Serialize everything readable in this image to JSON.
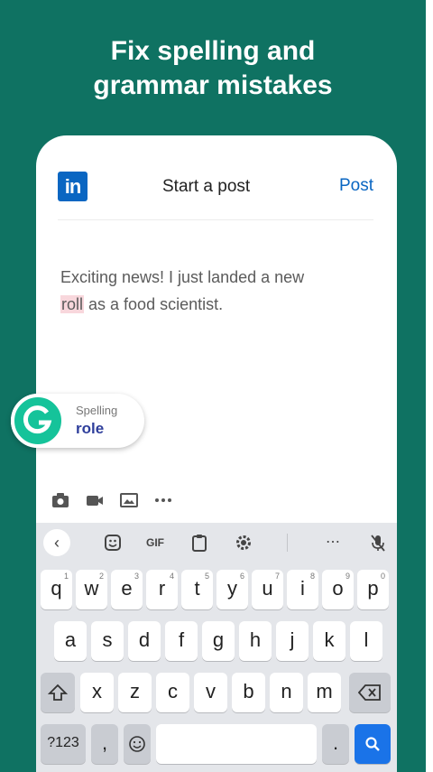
{
  "headline": {
    "line1": "Fix spelling and",
    "line2": "grammar mistakes"
  },
  "post_screen": {
    "logo_text": "in",
    "title": "Start a post",
    "post_label": "Post",
    "text_before": "Exciting news! I just landed a new",
    "misspelled_word": "roll",
    "text_after": " as a food scientist."
  },
  "suggestion": {
    "label": "Spelling",
    "word": "role"
  },
  "keyboard": {
    "toolbar": {
      "gif_label": "GIF"
    },
    "row1": [
      {
        "key": "q",
        "num": "1"
      },
      {
        "key": "w",
        "num": "2"
      },
      {
        "key": "e",
        "num": "3"
      },
      {
        "key": "r",
        "num": "4"
      },
      {
        "key": "t",
        "num": "5"
      },
      {
        "key": "y",
        "num": "6"
      },
      {
        "key": "u",
        "num": "7"
      },
      {
        "key": "i",
        "num": "8"
      },
      {
        "key": "o",
        "num": "9"
      },
      {
        "key": "p",
        "num": "0"
      }
    ],
    "row2": [
      "a",
      "s",
      "d",
      "f",
      "g",
      "h",
      "j",
      "k",
      "l"
    ],
    "row3": [
      "x",
      "z",
      "c",
      "v",
      "b",
      "n",
      "m"
    ],
    "symbols_label": "?123",
    "comma_label": ",",
    "period_label": "."
  },
  "colors": {
    "background_green": "#0f7262",
    "linkedin_blue": "#0a66c2",
    "grammarly_green": "#15c39a",
    "highlight_pink": "#f8d7dc"
  }
}
